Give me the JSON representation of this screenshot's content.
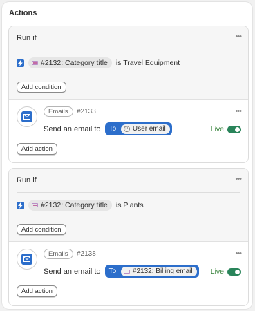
{
  "panel": {
    "title": "Actions"
  },
  "rules": [
    {
      "run_if_label": "Run if",
      "condition": {
        "field_label": "#2132: Category title",
        "operator_text": "is Travel Equipment"
      },
      "add_condition_label": "Add condition",
      "action": {
        "app_label": "Emails",
        "id_label": "#2133",
        "send_text": "Send an email to",
        "to_prefix": "To:",
        "recipient_label": "User email",
        "recipient_icon": "circle-p-icon",
        "status_label": "Live",
        "status_on": true
      },
      "add_action_label": "Add action"
    },
    {
      "run_if_label": "Run if",
      "condition": {
        "field_label": "#2132: Category title",
        "operator_text": "is Plants"
      },
      "add_condition_label": "Add condition",
      "action": {
        "app_label": "Emails",
        "id_label": "#2138",
        "send_text": "Send an email to",
        "to_prefix": "To:",
        "recipient_label": "#2132: Billing email",
        "recipient_icon": "tag-icon",
        "status_label": "Live",
        "status_on": true
      },
      "add_action_label": "Add action"
    }
  ],
  "colors": {
    "accent": "#2c6ecb",
    "live_green": "#29845a",
    "tag_purple": "#c46ba3"
  }
}
